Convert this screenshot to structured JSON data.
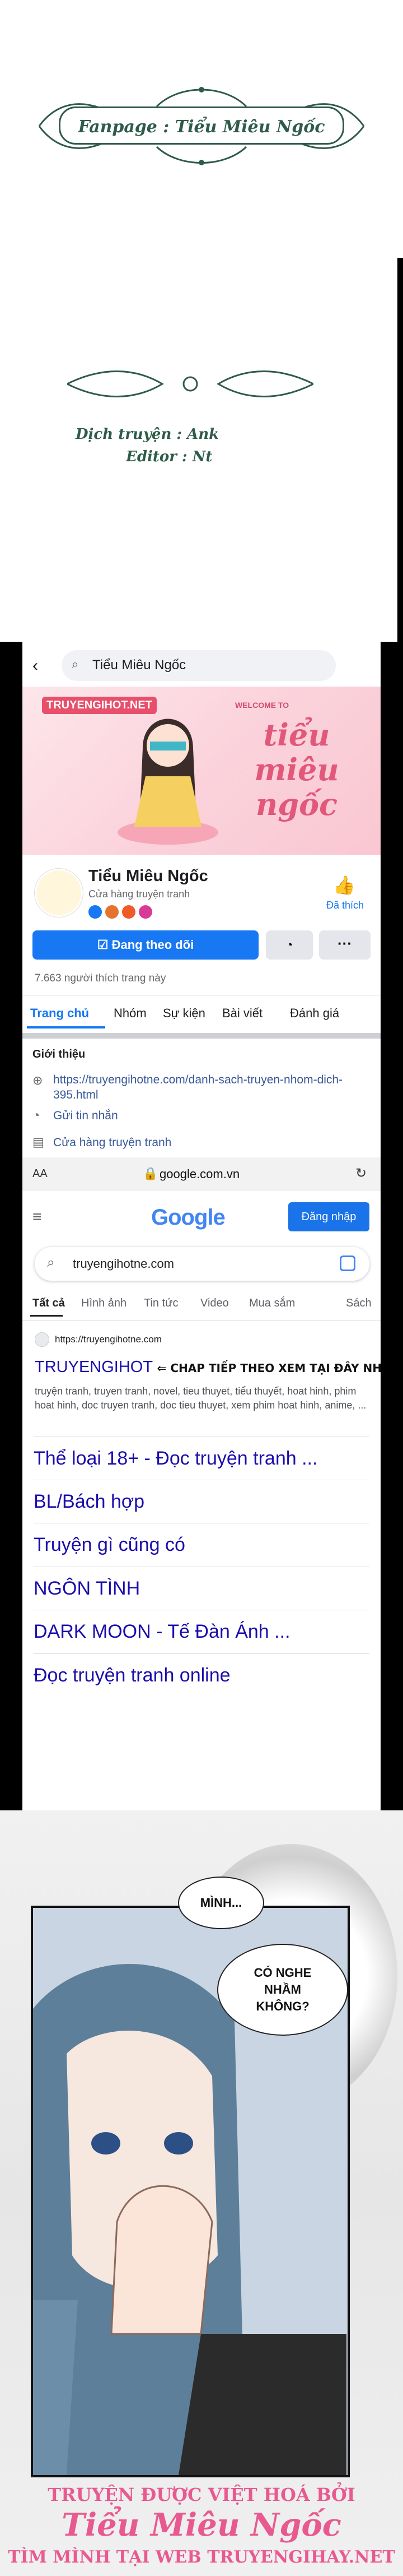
{
  "banner": {
    "text": "Fanpage : Tiểu Miêu Ngốc"
  },
  "credits": {
    "translator": "Dịch truyện : Ank",
    "editor": "Editor : Nt"
  },
  "facebook": {
    "search_text": "Tiểu Miêu Ngốc",
    "cover_site": "TRUYENGIHOT.NET",
    "cover_welcome": "WELCOME TO",
    "cover_title": "tiểu miêu ngốc",
    "page_name": "Tiểu Miêu Ngốc",
    "page_category": "Cửa hàng truyện tranh",
    "liked_label": "Đã thích",
    "following_button": "Đang theo dõi",
    "likes_count": "7.663 người thích trang này",
    "tabs": [
      "Trang chủ",
      "Nhóm",
      "Sự kiện",
      "Bài viết",
      "Đánh giá"
    ],
    "intro_title": "Giới thiệu",
    "intro_link": "https://truyengihotne.com/danh-sach-truyen-nhom-dich-395.html",
    "message_label": "Gửi tin nhắn",
    "store_label": "Cửa hàng truyện tranh"
  },
  "browser": {
    "aa": "AA",
    "domain": "google.com.vn"
  },
  "google": {
    "logo": "Google",
    "login_button": "Đăng nhập",
    "query": "truyengihotne.com",
    "tabs": [
      "Tất cả",
      "Hình ảnh",
      "Tin tức",
      "Video",
      "Mua sắm",
      "Sách"
    ],
    "result_url": "https://truyengihotne.com",
    "result_title": "TRUYENGIHOT",
    "result_note": "⇐ CHAP TIẾP THEO XEM TẠI ĐÂY NHA",
    "result_snippet": "truyện tranh, truyen tranh, novel, tieu thuyet, tiểu thuyết, hoat hinh, phim hoat hinh, doc truyen tranh, doc tieu thuyet, xem phim hoat hinh, anime, ...",
    "sitelinks": [
      "Thể loại 18+ - Đọc truyện tranh ...",
      "BL/Bách hợp",
      "Truyện gì cũng có",
      "NGÔN TÌNH",
      "DARK MOON - Tế Đàn Ánh ...",
      "Đọc truyện tranh online"
    ]
  },
  "comic": {
    "bubble1": "MÌNH...",
    "bubble2": "CÓ NGHE NHẦM KHÔNG?"
  },
  "footer": {
    "line1": "TRUYỆN ĐƯỢC VIỆT HOÁ BỞI",
    "line2": "Tiểu Miêu Ngốc",
    "line3": "TÌM MÌNH TẠI WEB TRUYENGIHAY.NET"
  },
  "colors": {
    "fb_blue": "#1877f2",
    "banner_green": "#2e5c49",
    "footer_pink": "#e85a8f",
    "google_blue": "#1a0dab"
  }
}
